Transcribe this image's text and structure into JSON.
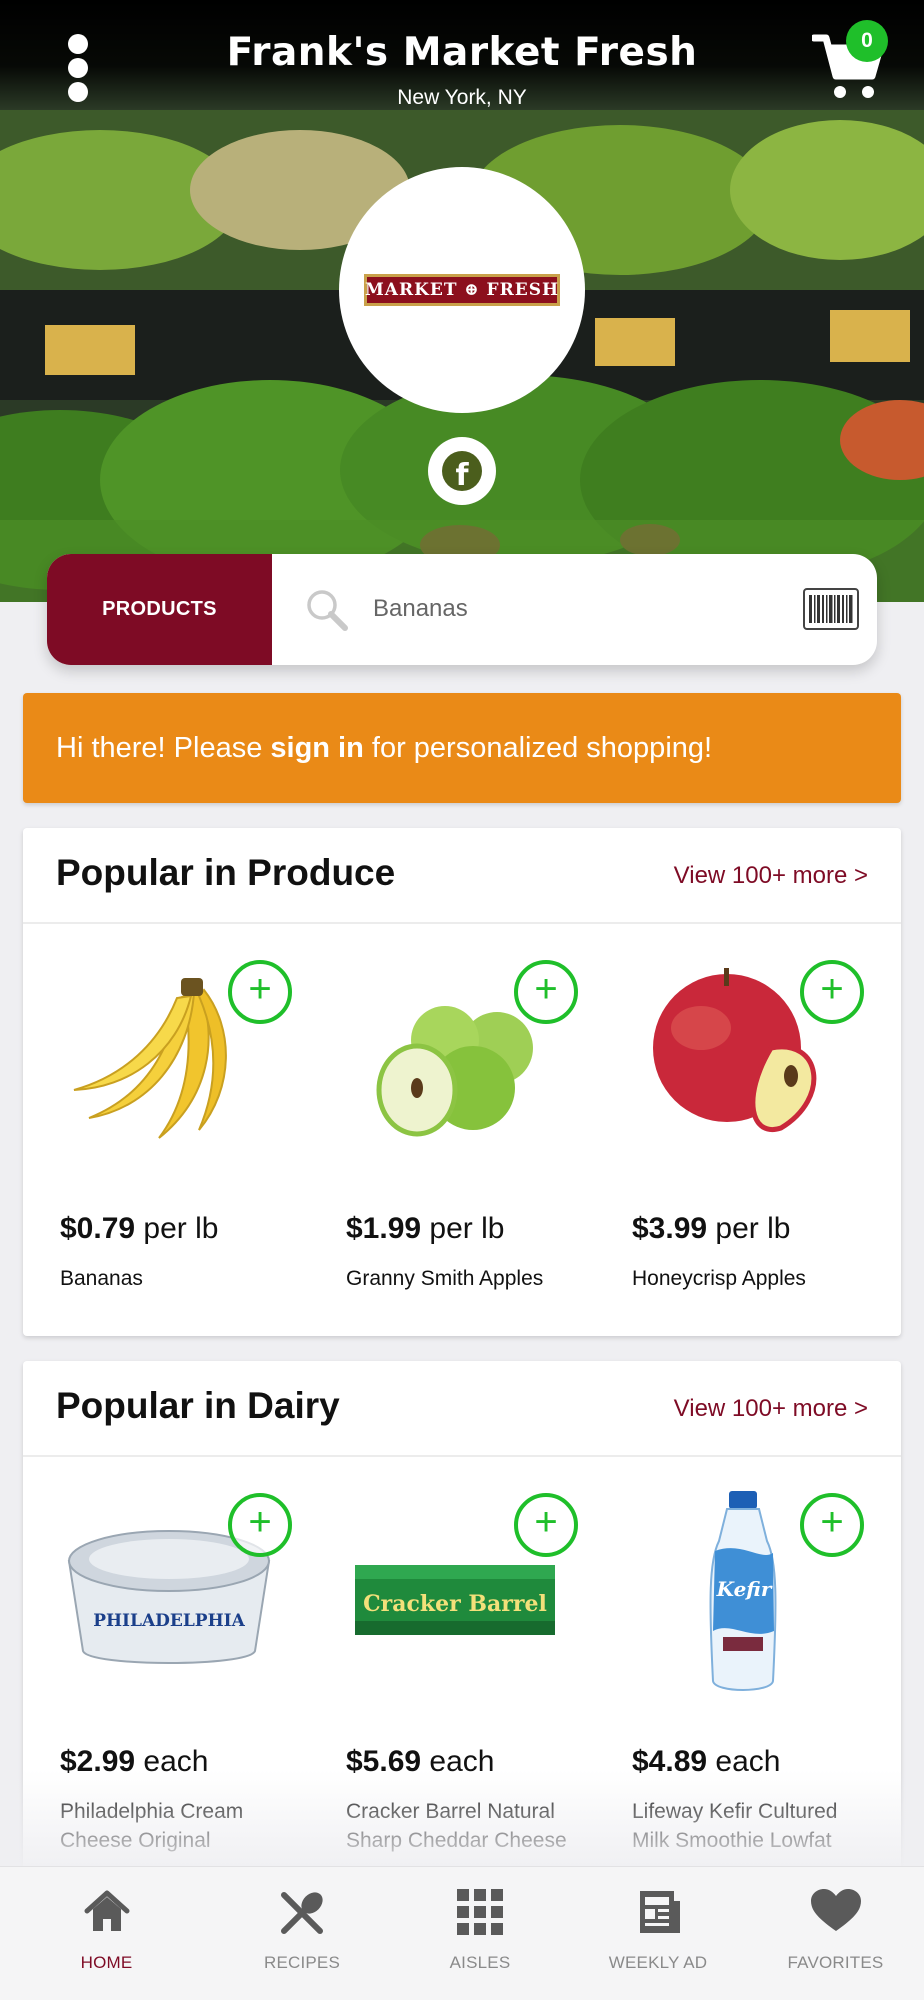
{
  "header": {
    "store_name": "Frank's Market Fresh",
    "location": "New York, NY",
    "cart_count": "0",
    "logo_text": "MARKET ⊕ FRESH"
  },
  "search": {
    "tab_label": "PRODUCTS",
    "placeholder": "Bananas"
  },
  "banner": {
    "prefix": "Hi there! Please ",
    "link": "sign in",
    "suffix": " for personalized shopping!"
  },
  "sections": [
    {
      "title": "Popular in Produce",
      "more": "View 100+ more >",
      "products": [
        {
          "price": "$0.79",
          "unit": " per lb",
          "name": "Bananas",
          "image": "bananas"
        },
        {
          "price": "$1.99",
          "unit": " per lb",
          "name": "Granny Smith Apples",
          "image": "green-apples"
        },
        {
          "price": "$3.99",
          "unit": " per lb",
          "name": "Honeycrisp Apples",
          "image": "red-apple"
        }
      ]
    },
    {
      "title": "Popular in Dairy",
      "more": "View 100+ more >",
      "products": [
        {
          "price": "$2.99",
          "unit": " each",
          "name": "Philadelphia Cream Cheese Original",
          "image": "cream-cheese-tub",
          "image_text": "PHILADELPHIA"
        },
        {
          "price": "$5.69",
          "unit": " each",
          "name": "Cracker Barrel Natural Sharp Cheddar Cheese",
          "image": "cheddar-block",
          "image_text": "Cracker Barrel"
        },
        {
          "price": "$4.89",
          "unit": " each",
          "name": "Lifeway Kefir Cultured Milk Smoothie Lowfat",
          "image": "kefir-bottle",
          "image_text": "Kefir"
        }
      ]
    }
  ],
  "nav": [
    {
      "label": "HOME",
      "icon": "home-icon",
      "active": true
    },
    {
      "label": "RECIPES",
      "icon": "utensils-icon",
      "active": false
    },
    {
      "label": "AISLES",
      "icon": "grid-icon",
      "active": false
    },
    {
      "label": "WEEKLY AD",
      "icon": "newspaper-icon",
      "active": false
    },
    {
      "label": "FAVORITES",
      "icon": "heart-icon",
      "active": false
    }
  ],
  "colors": {
    "brand": "#7e0b25",
    "banner": "#ea8a17",
    "add_green": "#1fbf2a"
  }
}
